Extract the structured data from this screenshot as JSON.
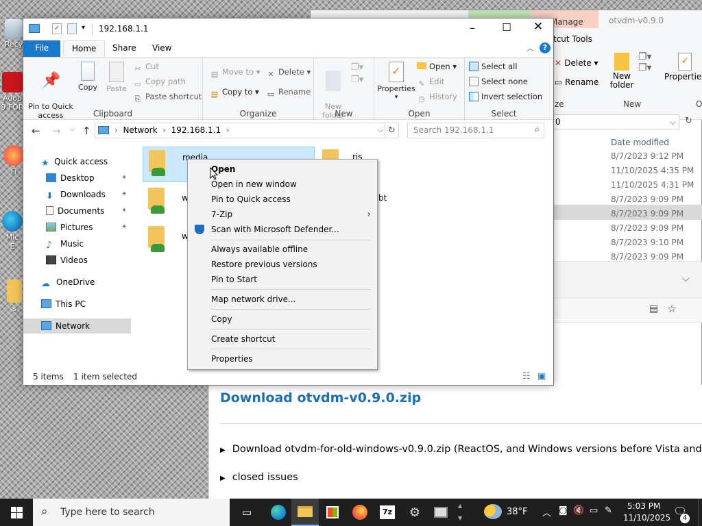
{
  "desktop": {
    "icons": [
      {
        "label": "Recy"
      },
      {
        "label": "Adob"
      },
      {
        "label": "9 FOR"
      },
      {
        "label": "Fi"
      },
      {
        "label": "Mic"
      },
      {
        "label": "E"
      },
      {
        "label": "s"
      }
    ]
  },
  "back_window": {
    "title": "otvdm-v0.9.0",
    "context_tab": "Manage",
    "tools_tab": "tcut Tools",
    "buttons": {
      "delete": "Delete",
      "rename": "Rename",
      "new_folder": "New\nfolder",
      "properties": "Properties"
    },
    "groups": {
      "organize_suffix": "ze",
      "new": "New",
      "open_prefix": "O"
    },
    "address_suffix": "0",
    "column_date": "Date modified",
    "dates": [
      "8/7/2023 9:12 PM",
      "11/10/2025 4:35 PM",
      "11/10/2025 4:31 PM",
      "8/7/2023 9:09 PM",
      "8/7/2023 9:09 PM",
      "8/7/2023 9:09 PM",
      "8/7/2023 9:10 PM",
      "8/7/2023 9:09 PM"
    ]
  },
  "web": {
    "heading": "Download otvdm-v0.9.0.zip",
    "bullets": [
      "Download otvdm-for-old-windows-v0.9.0.zip (ReactOS, and Windows versions before Vista and Se",
      "closed issues"
    ]
  },
  "explorer": {
    "title": "192.168.1.1",
    "tabs": {
      "file": "File",
      "home": "Home",
      "share": "Share",
      "view": "View"
    },
    "clipboard": {
      "pin": "Pin to Quick\naccess",
      "copy": "Copy",
      "paste": "Paste",
      "cut": "Cut",
      "copy_path": "Copy path",
      "paste_shortcut": "Paste shortcut",
      "label": "Clipboard"
    },
    "organize": {
      "move_to": "Move to",
      "copy_to": "Copy to",
      "delete": "Delete",
      "rename": "Rename",
      "label": "Organize"
    },
    "new": {
      "new_folder": "New\nfolder",
      "label": "New"
    },
    "open": {
      "properties": "Properties",
      "open": "Open",
      "edit": "Edit",
      "history": "History",
      "label": "Open"
    },
    "select": {
      "select_all": "Select all",
      "select_none": "Select none",
      "invert": "Invert selection",
      "label": "Select"
    },
    "address": {
      "crumbs": [
        "Network",
        "192.168.1.1"
      ],
      "search_placeholder": "Search 192.168.1.1"
    },
    "nav": {
      "quick_access": "Quick access",
      "items": [
        "Desktop",
        "Downloads",
        "Documents",
        "Pictures",
        "Music",
        "Videos"
      ],
      "onedrive": "OneDrive",
      "this_pc": "This PC",
      "network": "Network"
    },
    "files": [
      {
        "name": "media"
      },
      {
        "name": "ris"
      },
      {
        "name": "w"
      },
      {
        "name": "bt"
      },
      {
        "name": "w"
      }
    ],
    "status": {
      "count": "5 items",
      "selected": "1 item selected"
    }
  },
  "context_menu": {
    "items": [
      "Open",
      "Open in new window",
      "Pin to Quick access",
      "7-Zip",
      "Scan with Microsoft Defender...",
      "Always available offline",
      "Restore previous versions",
      "Pin to Start",
      "Map network drive...",
      "Copy",
      "Create shortcut",
      "Properties"
    ]
  },
  "taskbar": {
    "search_placeholder": "Type here to search",
    "weather": "38°F",
    "time": "5:03 PM",
    "date": "11/10/2025",
    "notifications": "4"
  },
  "colors": {
    "accent": "#1979ca",
    "selection": "#cce8ff",
    "taskbar": "#1f1f1f",
    "link": "#1a6fb5"
  }
}
